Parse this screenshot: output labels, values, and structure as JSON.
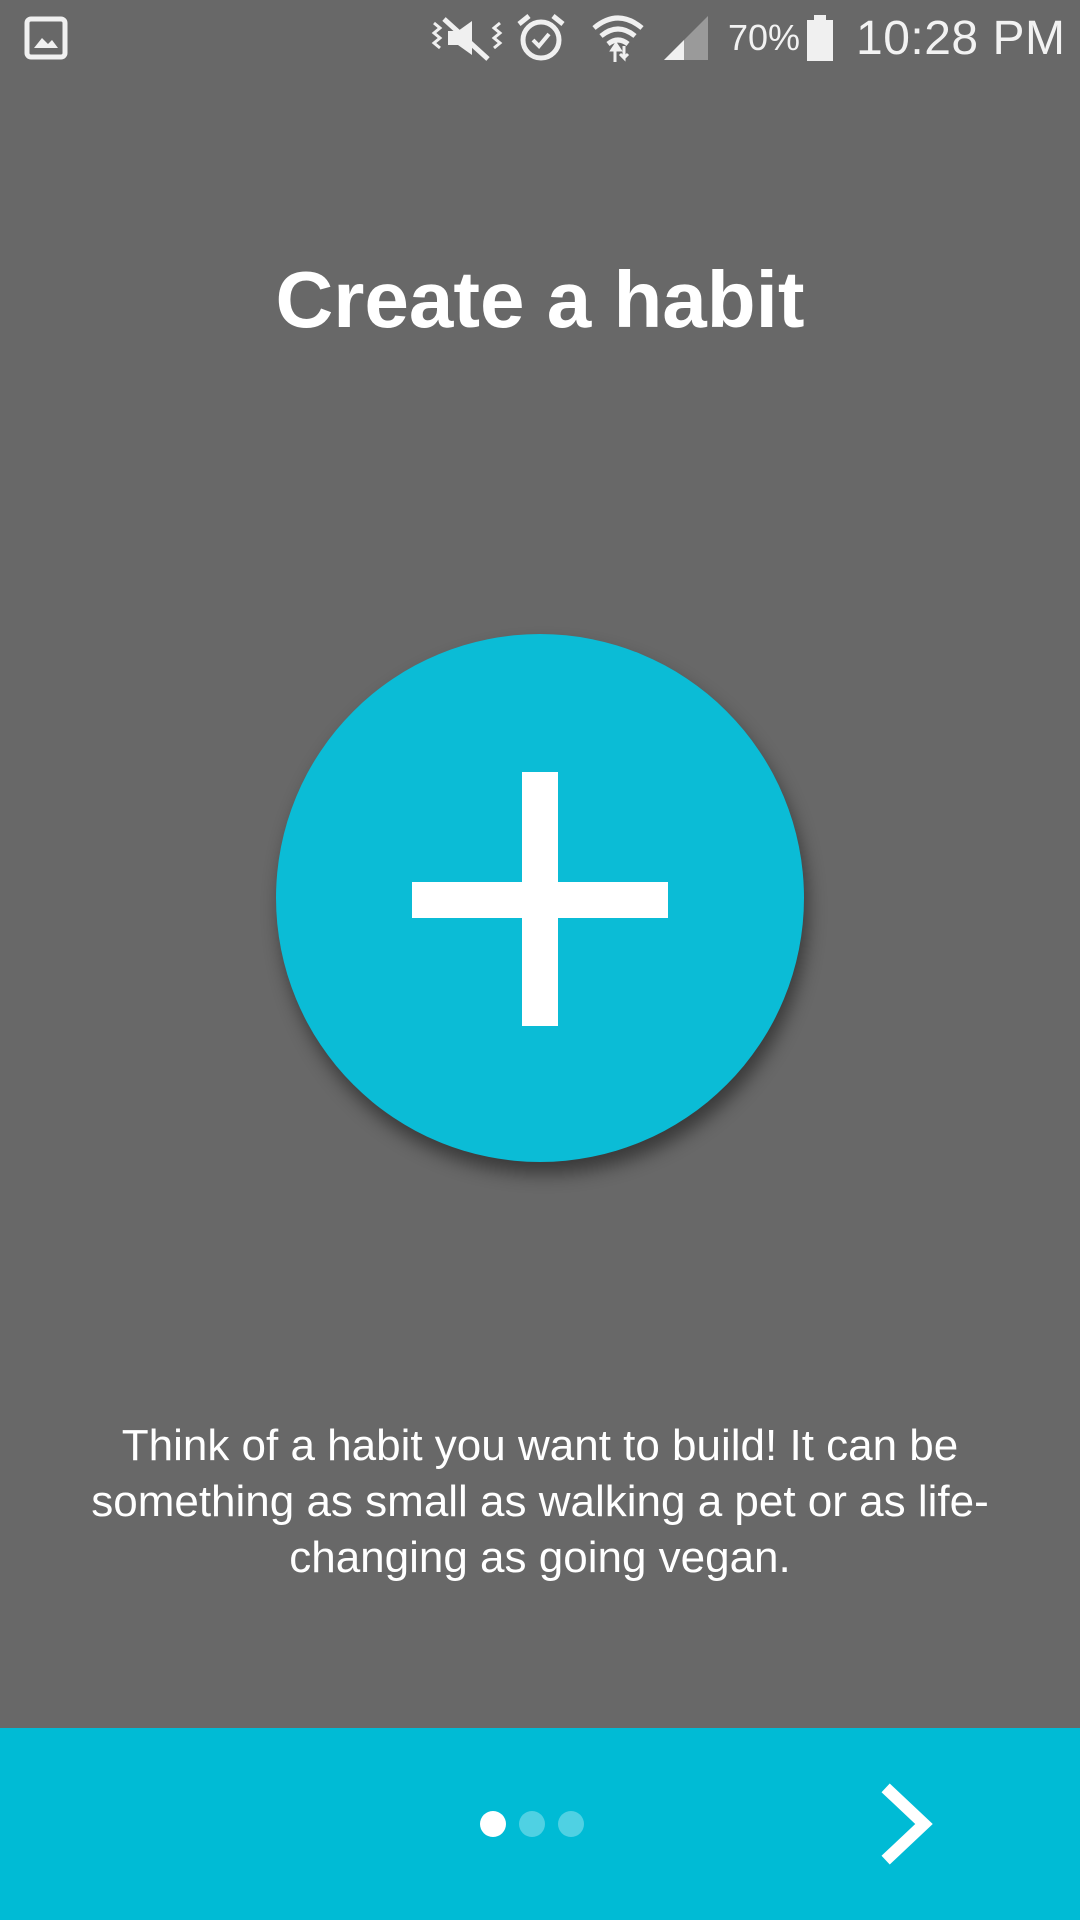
{
  "status_bar": {
    "battery_percent": "70%",
    "time": "10:28 PM",
    "icons": [
      "gallery-icon",
      "vibrate-mute-icon",
      "alarm-icon",
      "wifi-icon",
      "signal-icon",
      "battery-icon"
    ]
  },
  "onboarding": {
    "title": "Create a habit",
    "description": "Think of a habit you want to build! It can be something as small as walking a pet or as life-changing as going vegan.",
    "page_index": 1,
    "page_count": 3
  },
  "colors": {
    "background": "#686868",
    "accent": "#00bbd5",
    "circle": "#0bbcd6"
  }
}
